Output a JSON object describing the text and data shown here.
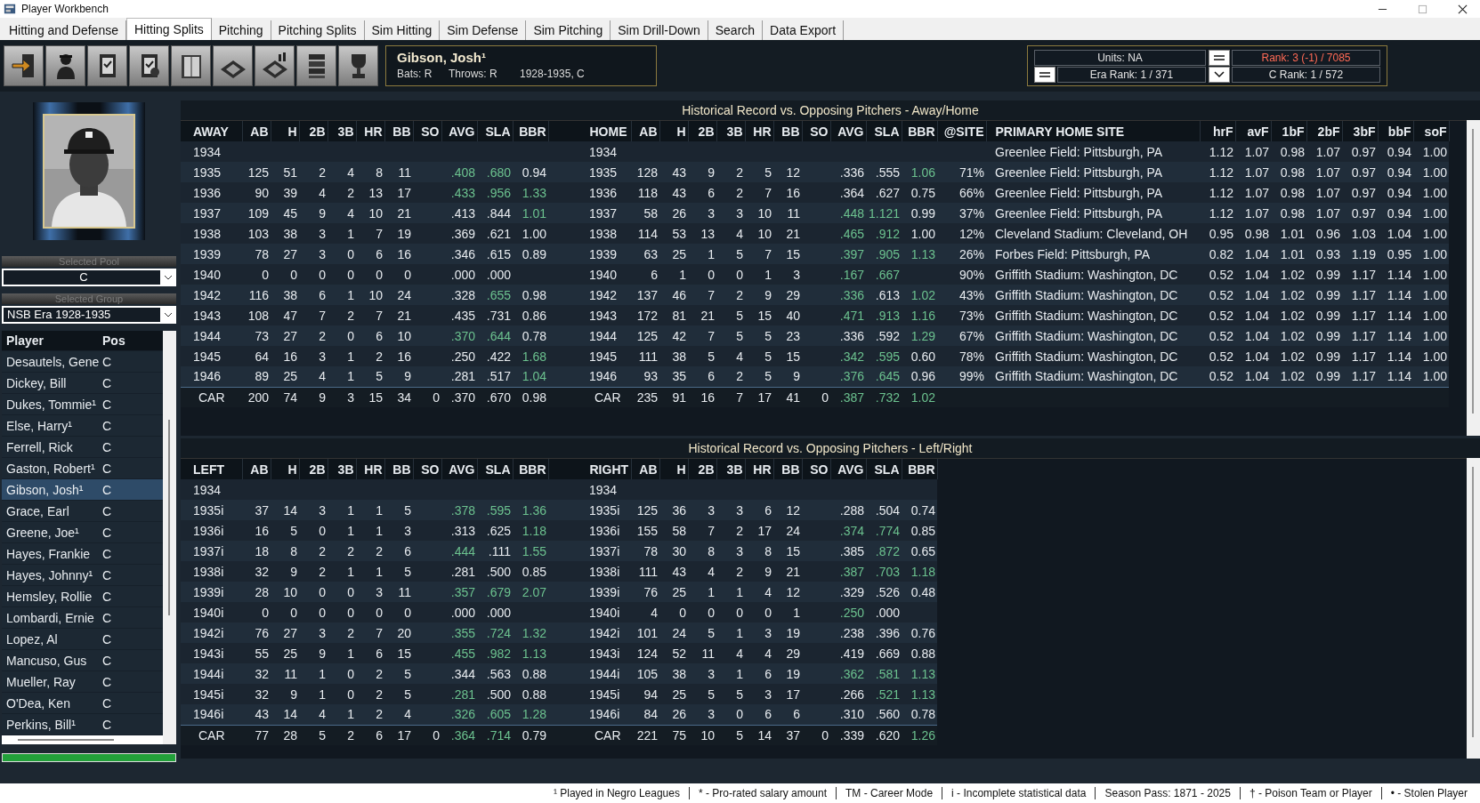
{
  "window": {
    "title": "Player Workbench"
  },
  "tabs": [
    {
      "label": "Hitting and Defense",
      "selected": false
    },
    {
      "label": "Hitting Splits",
      "selected": true
    },
    {
      "label": "Pitching",
      "selected": false
    },
    {
      "label": "Pitching Splits",
      "selected": false
    },
    {
      "label": "Sim Hitting",
      "selected": false
    },
    {
      "label": "Sim Defense",
      "selected": false
    },
    {
      "label": "Sim Pitching",
      "selected": false
    },
    {
      "label": "Sim Drill-Down",
      "selected": false
    },
    {
      "label": "Search",
      "selected": false
    },
    {
      "label": "Data Export",
      "selected": false
    }
  ],
  "player": {
    "name": "Gibson, Josh¹",
    "bats": "Bats: R",
    "throws": "Throws: R",
    "years_position": "1928-1935, C"
  },
  "rank_panel": {
    "units": "Units: NA",
    "rank": "Rank: 3 (-1) / 7085",
    "era_rank": "Era Rank: 1 / 371",
    "position_rank": "C Rank: 1 / 572"
  },
  "sidebar": {
    "pool_label": "Selected Pool",
    "pool": "C",
    "group_label": "Selected Group",
    "group": "NSB Era 1928-1935",
    "list_columns": [
      "Player",
      "Pos"
    ],
    "players": [
      {
        "name": "Desautels, Gene",
        "pos": "C",
        "selected": false
      },
      {
        "name": "Dickey, Bill",
        "pos": "C",
        "selected": false
      },
      {
        "name": "Dukes, Tommie¹",
        "pos": "C",
        "selected": false
      },
      {
        "name": "Else, Harry¹",
        "pos": "C",
        "selected": false
      },
      {
        "name": "Ferrell, Rick",
        "pos": "C",
        "selected": false
      },
      {
        "name": "Gaston, Robert¹",
        "pos": "C",
        "selected": false
      },
      {
        "name": "Gibson, Josh¹",
        "pos": "C",
        "selected": true
      },
      {
        "name": "Grace, Earl",
        "pos": "C",
        "selected": false
      },
      {
        "name": "Greene, Joe¹",
        "pos": "C",
        "selected": false
      },
      {
        "name": "Hayes, Frankie",
        "pos": "C",
        "selected": false
      },
      {
        "name": "Hayes, Johnny¹",
        "pos": "C",
        "selected": false
      },
      {
        "name": "Hemsley, Rollie",
        "pos": "C",
        "selected": false
      },
      {
        "name": "Lombardi, Ernie",
        "pos": "C",
        "selected": false
      },
      {
        "name": "Lopez, Al",
        "pos": "C",
        "selected": false
      },
      {
        "name": "Mancuso, Gus",
        "pos": "C",
        "selected": false
      },
      {
        "name": "Mueller, Ray",
        "pos": "C",
        "selected": false
      },
      {
        "name": "O'Dea, Ken",
        "pos": "C",
        "selected": false
      },
      {
        "name": "Perkins, Bill¹",
        "pos": "C",
        "selected": false
      }
    ],
    "progress": {
      "level": 1
    }
  },
  "away_home": {
    "title": "Historical Record vs. Opposing Pitchers - Away/Home",
    "columns": [
      {
        "label": "AWAY",
        "kind": "year"
      },
      {
        "label": "AB",
        "kind": "count"
      },
      {
        "label": "H",
        "kind": "count"
      },
      {
        "label": "2B",
        "kind": "count"
      },
      {
        "label": "3B",
        "kind": "count"
      },
      {
        "label": "HR",
        "kind": "count"
      },
      {
        "label": "BB",
        "kind": "count"
      },
      {
        "label": "SO",
        "kind": "count"
      },
      {
        "label": "AVG",
        "kind": "rate"
      },
      {
        "label": "SLA",
        "kind": "rate"
      },
      {
        "label": "BBR",
        "kind": "rate"
      },
      {
        "label": "HOME",
        "kind": "year"
      },
      {
        "label": "AB",
        "kind": "count"
      },
      {
        "label": "H",
        "kind": "count"
      },
      {
        "label": "2B",
        "kind": "count"
      },
      {
        "label": "3B",
        "kind": "count"
      },
      {
        "label": "HR",
        "kind": "count"
      },
      {
        "label": "BB",
        "kind": "count"
      },
      {
        "label": "SO",
        "kind": "count"
      },
      {
        "label": "AVG",
        "kind": "rate"
      },
      {
        "label": "SLA",
        "kind": "rate"
      },
      {
        "label": "BBR",
        "kind": "rate"
      },
      {
        "label": "@SITE",
        "kind": "pct"
      },
      {
        "label": "PRIMARY HOME SITE",
        "kind": "site"
      },
      {
        "label": "hrF",
        "kind": "factor"
      },
      {
        "label": "avF",
        "kind": "factor"
      },
      {
        "label": "1bF",
        "kind": "factor"
      },
      {
        "label": "2bF",
        "kind": "factor"
      },
      {
        "label": "3bF",
        "kind": "factor"
      },
      {
        "label": "bbF",
        "kind": "factor"
      },
      {
        "label": "soF",
        "kind": "factor"
      }
    ],
    "rows": [
      {
        "kind": "season",
        "cells": [
          "1934",
          null,
          null,
          null,
          null,
          null,
          null,
          null,
          null,
          null,
          null,
          "1934",
          null,
          null,
          null,
          null,
          null,
          null,
          null,
          null,
          null,
          null,
          null,
          "Greenlee Field: Pittsburgh, PA",
          "1.12",
          "1.07",
          "0.98",
          "1.07",
          "0.97",
          "0.94",
          "1.00"
        ]
      },
      {
        "kind": "season",
        "cells": [
          "1935",
          "125",
          "51",
          "2",
          "4",
          "8",
          "11",
          null,
          {
            "v": ".408",
            "good": true
          },
          {
            "v": ".680",
            "good": true
          },
          {
            "v": "0.94",
            "good": false
          },
          "1935",
          "128",
          "43",
          "9",
          "2",
          "5",
          "12",
          null,
          {
            "v": ".336",
            "good": false
          },
          {
            "v": ".555",
            "good": false
          },
          {
            "v": "1.06",
            "good": true
          },
          "71%",
          "Greenlee Field: Pittsburgh, PA",
          "1.12",
          "1.07",
          "0.98",
          "1.07",
          "0.97",
          "0.94",
          "1.00"
        ]
      },
      {
        "kind": "season",
        "cells": [
          "1936",
          "90",
          "39",
          "4",
          "2",
          "13",
          "17",
          null,
          {
            "v": ".433",
            "good": true
          },
          {
            "v": ".956",
            "good": true
          },
          {
            "v": "1.33",
            "good": true
          },
          "1936",
          "118",
          "43",
          "6",
          "2",
          "7",
          "16",
          null,
          {
            "v": ".364",
            "good": false
          },
          {
            "v": ".627",
            "good": false
          },
          {
            "v": "0.75",
            "good": false
          },
          "66%",
          "Greenlee Field: Pittsburgh, PA",
          "1.12",
          "1.07",
          "0.98",
          "1.07",
          "0.97",
          "0.94",
          "1.00"
        ]
      },
      {
        "kind": "season",
        "cells": [
          "1937",
          "109",
          "45",
          "9",
          "4",
          "10",
          "21",
          null,
          {
            "v": ".413",
            "good": false
          },
          {
            "v": ".844",
            "good": false
          },
          {
            "v": "1.01",
            "good": true
          },
          "1937",
          "58",
          "26",
          "3",
          "3",
          "10",
          "11",
          null,
          {
            "v": ".448",
            "good": true
          },
          {
            "v": "1.121",
            "good": true
          },
          {
            "v": "0.99",
            "good": false
          },
          "37%",
          "Greenlee Field: Pittsburgh, PA",
          "1.12",
          "1.07",
          "0.98",
          "1.07",
          "0.97",
          "0.94",
          "1.00"
        ]
      },
      {
        "kind": "season",
        "cells": [
          "1938",
          "103",
          "38",
          "3",
          "1",
          "7",
          "19",
          null,
          {
            "v": ".369",
            "good": false
          },
          {
            "v": ".621",
            "good": false
          },
          {
            "v": "1.00",
            "good": false
          },
          "1938",
          "114",
          "53",
          "13",
          "4",
          "10",
          "21",
          null,
          {
            "v": ".465",
            "good": true
          },
          {
            "v": ".912",
            "good": true
          },
          {
            "v": "1.00",
            "good": false
          },
          "12%",
          "Cleveland Stadium: Cleveland, OH",
          "0.95",
          "0.98",
          "1.01",
          "0.96",
          "1.03",
          "1.04",
          "1.00"
        ]
      },
      {
        "kind": "season",
        "cells": [
          "1939",
          "78",
          "27",
          "3",
          "0",
          "6",
          "16",
          null,
          {
            "v": ".346",
            "good": false
          },
          {
            "v": ".615",
            "good": false
          },
          {
            "v": "0.89",
            "good": false
          },
          "1939",
          "63",
          "25",
          "1",
          "5",
          "7",
          "15",
          null,
          {
            "v": ".397",
            "good": true
          },
          {
            "v": ".905",
            "good": true
          },
          {
            "v": "1.13",
            "good": true
          },
          "26%",
          "Forbes Field: Pittsburgh, PA",
          "0.82",
          "1.04",
          "1.01",
          "0.93",
          "1.19",
          "0.95",
          "1.00"
        ]
      },
      {
        "kind": "season",
        "cells": [
          "1940",
          "0",
          "0",
          "0",
          "0",
          "0",
          "0",
          null,
          {
            "v": ".000",
            "good": false
          },
          {
            "v": ".000",
            "good": false
          },
          null,
          "1940",
          "6",
          "1",
          "0",
          "0",
          "1",
          "3",
          null,
          {
            "v": ".167",
            "good": true
          },
          {
            "v": ".667",
            "good": true
          },
          null,
          "90%",
          "Griffith Stadium: Washington, DC",
          "0.52",
          "1.04",
          "1.02",
          "0.99",
          "1.17",
          "1.14",
          "1.00"
        ]
      },
      {
        "kind": "season",
        "cells": [
          "1942",
          "116",
          "38",
          "6",
          "1",
          "10",
          "24",
          null,
          {
            "v": ".328",
            "good": false
          },
          {
            "v": ".655",
            "good": true
          },
          {
            "v": "0.98",
            "good": false
          },
          "1942",
          "137",
          "46",
          "7",
          "2",
          "9",
          "29",
          null,
          {
            "v": ".336",
            "good": true
          },
          {
            "v": ".613",
            "good": false
          },
          {
            "v": "1.02",
            "good": true
          },
          "43%",
          "Griffith Stadium: Washington, DC",
          "0.52",
          "1.04",
          "1.02",
          "0.99",
          "1.17",
          "1.14",
          "1.00"
        ]
      },
      {
        "kind": "season",
        "cells": [
          "1943",
          "108",
          "47",
          "7",
          "2",
          "7",
          "21",
          null,
          {
            "v": ".435",
            "good": false
          },
          {
            "v": ".731",
            "good": false
          },
          {
            "v": "0.86",
            "good": false
          },
          "1943",
          "172",
          "81",
          "21",
          "5",
          "15",
          "40",
          null,
          {
            "v": ".471",
            "good": true
          },
          {
            "v": ".913",
            "good": true
          },
          {
            "v": "1.16",
            "good": true
          },
          "73%",
          "Griffith Stadium: Washington, DC",
          "0.52",
          "1.04",
          "1.02",
          "0.99",
          "1.17",
          "1.14",
          "1.00"
        ]
      },
      {
        "kind": "season",
        "cells": [
          "1944",
          "73",
          "27",
          "2",
          "0",
          "6",
          "10",
          null,
          {
            "v": ".370",
            "good": true
          },
          {
            "v": ".644",
            "good": true
          },
          {
            "v": "0.78",
            "good": false
          },
          "1944",
          "125",
          "42",
          "7",
          "5",
          "5",
          "23",
          null,
          {
            "v": ".336",
            "good": false
          },
          {
            "v": ".592",
            "good": false
          },
          {
            "v": "1.29",
            "good": true
          },
          "67%",
          "Griffith Stadium: Washington, DC",
          "0.52",
          "1.04",
          "1.02",
          "0.99",
          "1.17",
          "1.14",
          "1.00"
        ]
      },
      {
        "kind": "season",
        "cells": [
          "1945",
          "64",
          "16",
          "3",
          "1",
          "2",
          "16",
          null,
          {
            "v": ".250",
            "good": false
          },
          {
            "v": ".422",
            "good": false
          },
          {
            "v": "1.68",
            "good": true
          },
          "1945",
          "111",
          "38",
          "5",
          "4",
          "5",
          "15",
          null,
          {
            "v": ".342",
            "good": true
          },
          {
            "v": ".595",
            "good": true
          },
          {
            "v": "0.60",
            "good": false
          },
          "78%",
          "Griffith Stadium: Washington, DC",
          "0.52",
          "1.04",
          "1.02",
          "0.99",
          "1.17",
          "1.14",
          "1.00"
        ]
      },
      {
        "kind": "season",
        "cells": [
          "1946",
          "89",
          "25",
          "4",
          "1",
          "5",
          "9",
          null,
          {
            "v": ".281",
            "good": false
          },
          {
            "v": ".517",
            "good": false
          },
          {
            "v": "1.04",
            "good": true
          },
          "1946",
          "93",
          "35",
          "6",
          "2",
          "5",
          "9",
          null,
          {
            "v": ".376",
            "good": true
          },
          {
            "v": ".645",
            "good": true
          },
          {
            "v": "0.96",
            "good": false
          },
          "99%",
          "Griffith Stadium: Washington, DC",
          "0.52",
          "1.04",
          "1.02",
          "0.99",
          "1.17",
          "1.14",
          "1.00"
        ]
      },
      {
        "kind": "career",
        "cells": [
          "CAR",
          "200",
          "74",
          "9",
          "3",
          "15",
          "34",
          "0",
          {
            "v": ".370",
            "good": false
          },
          {
            "v": ".670",
            "good": false
          },
          {
            "v": "0.98",
            "good": false
          },
          "CAR",
          "235",
          "91",
          "16",
          "7",
          "17",
          "41",
          "0",
          {
            "v": ".387",
            "good": true
          },
          {
            "v": ".732",
            "good": true
          },
          {
            "v": "1.02",
            "good": true
          },
          null,
          null,
          null,
          null,
          null,
          null,
          null,
          null,
          null
        ]
      }
    ]
  },
  "left_right": {
    "title": "Historical Record vs. Opposing Pitchers - Left/Right",
    "columns": [
      {
        "label": "LEFT",
        "kind": "year"
      },
      {
        "label": "AB",
        "kind": "count"
      },
      {
        "label": "H",
        "kind": "count"
      },
      {
        "label": "2B",
        "kind": "count"
      },
      {
        "label": "3B",
        "kind": "count"
      },
      {
        "label": "HR",
        "kind": "count"
      },
      {
        "label": "BB",
        "kind": "count"
      },
      {
        "label": "SO",
        "kind": "count"
      },
      {
        "label": "AVG",
        "kind": "rate"
      },
      {
        "label": "SLA",
        "kind": "rate"
      },
      {
        "label": "BBR",
        "kind": "rate"
      },
      {
        "label": "RIGHT",
        "kind": "year"
      },
      {
        "label": "AB",
        "kind": "count"
      },
      {
        "label": "H",
        "kind": "count"
      },
      {
        "label": "2B",
        "kind": "count"
      },
      {
        "label": "3B",
        "kind": "count"
      },
      {
        "label": "HR",
        "kind": "count"
      },
      {
        "label": "BB",
        "kind": "count"
      },
      {
        "label": "SO",
        "kind": "count"
      },
      {
        "label": "AVG",
        "kind": "rate"
      },
      {
        "label": "SLA",
        "kind": "rate"
      },
      {
        "label": "BBR",
        "kind": "rate"
      }
    ],
    "rows": [
      {
        "kind": "season",
        "cells": [
          "1934",
          null,
          null,
          null,
          null,
          null,
          null,
          null,
          null,
          null,
          null,
          "1934",
          null,
          null,
          null,
          null,
          null,
          null,
          null,
          null,
          null,
          null
        ]
      },
      {
        "kind": "season",
        "cells": [
          "1935i",
          "37",
          "14",
          "3",
          "1",
          "1",
          "5",
          null,
          {
            "v": ".378",
            "good": true
          },
          {
            "v": ".595",
            "good": true
          },
          {
            "v": "1.36",
            "good": true
          },
          "1935i",
          "125",
          "36",
          "3",
          "3",
          "6",
          "12",
          null,
          {
            "v": ".288",
            "good": false
          },
          {
            "v": ".504",
            "good": false
          },
          {
            "v": "0.74",
            "good": false
          }
        ]
      },
      {
        "kind": "season",
        "cells": [
          "1936i",
          "16",
          "5",
          "0",
          "1",
          "1",
          "3",
          null,
          {
            "v": ".313",
            "good": false
          },
          {
            "v": ".625",
            "good": false
          },
          {
            "v": "1.18",
            "good": true
          },
          "1936i",
          "155",
          "58",
          "7",
          "2",
          "17",
          "24",
          null,
          {
            "v": ".374",
            "good": true
          },
          {
            "v": ".774",
            "good": true
          },
          {
            "v": "0.85",
            "good": false
          }
        ]
      },
      {
        "kind": "season",
        "cells": [
          "1937i",
          "18",
          "8",
          "2",
          "2",
          "2",
          "6",
          null,
          {
            "v": ".444",
            "good": true
          },
          {
            "v": ".111",
            "good": false
          },
          {
            "v": "1.55",
            "good": true
          },
          "1937i",
          "78",
          "30",
          "8",
          "3",
          "8",
          "15",
          null,
          {
            "v": ".385",
            "good": false
          },
          {
            "v": ".872",
            "good": true
          },
          {
            "v": "0.65",
            "good": false
          }
        ]
      },
      {
        "kind": "season",
        "cells": [
          "1938i",
          "32",
          "9",
          "2",
          "1",
          "1",
          "5",
          null,
          {
            "v": ".281",
            "good": false
          },
          {
            "v": ".500",
            "good": false
          },
          {
            "v": "0.85",
            "good": false
          },
          "1938i",
          "111",
          "43",
          "4",
          "2",
          "9",
          "21",
          null,
          {
            "v": ".387",
            "good": true
          },
          {
            "v": ".703",
            "good": true
          },
          {
            "v": "1.18",
            "good": true
          }
        ]
      },
      {
        "kind": "season",
        "cells": [
          "1939i",
          "28",
          "10",
          "0",
          "0",
          "3",
          "11",
          null,
          {
            "v": ".357",
            "good": true
          },
          {
            "v": ".679",
            "good": true
          },
          {
            "v": "2.07",
            "good": true
          },
          "1939i",
          "76",
          "25",
          "1",
          "1",
          "4",
          "12",
          null,
          {
            "v": ".329",
            "good": false
          },
          {
            "v": ".526",
            "good": false
          },
          {
            "v": "0.48",
            "good": false
          }
        ]
      },
      {
        "kind": "season",
        "cells": [
          "1940i",
          "0",
          "0",
          "0",
          "0",
          "0",
          "0",
          null,
          {
            "v": ".000",
            "good": false
          },
          {
            "v": ".000",
            "good": false
          },
          null,
          "1940i",
          "4",
          "0",
          "0",
          "0",
          "0",
          "1",
          null,
          {
            "v": ".250",
            "good": true
          },
          {
            "v": ".000",
            "good": false
          },
          null
        ]
      },
      {
        "kind": "season",
        "cells": [
          "1942i",
          "76",
          "27",
          "3",
          "2",
          "7",
          "20",
          null,
          {
            "v": ".355",
            "good": true
          },
          {
            "v": ".724",
            "good": true
          },
          {
            "v": "1.32",
            "good": true
          },
          "1942i",
          "101",
          "24",
          "5",
          "1",
          "3",
          "19",
          null,
          {
            "v": ".238",
            "good": false
          },
          {
            "v": ".396",
            "good": false
          },
          {
            "v": "0.76",
            "good": false
          }
        ]
      },
      {
        "kind": "season",
        "cells": [
          "1943i",
          "55",
          "25",
          "9",
          "1",
          "6",
          "15",
          null,
          {
            "v": ".455",
            "good": true
          },
          {
            "v": ".982",
            "good": true
          },
          {
            "v": "1.13",
            "good": true
          },
          "1943i",
          "124",
          "52",
          "11",
          "4",
          "4",
          "29",
          null,
          {
            "v": ".419",
            "good": false
          },
          {
            "v": ".669",
            "good": false
          },
          {
            "v": "0.88",
            "good": false
          }
        ]
      },
      {
        "kind": "season",
        "cells": [
          "1944i",
          "32",
          "11",
          "1",
          "0",
          "2",
          "5",
          null,
          {
            "v": ".344",
            "good": false
          },
          {
            "v": ".563",
            "good": false
          },
          {
            "v": "0.88",
            "good": false
          },
          "1944i",
          "105",
          "38",
          "3",
          "1",
          "6",
          "19",
          null,
          {
            "v": ".362",
            "good": true
          },
          {
            "v": ".581",
            "good": true
          },
          {
            "v": "1.13",
            "good": true
          }
        ]
      },
      {
        "kind": "season",
        "cells": [
          "1945i",
          "32",
          "9",
          "1",
          "0",
          "2",
          "5",
          null,
          {
            "v": ".281",
            "good": true
          },
          {
            "v": ".500",
            "good": false
          },
          {
            "v": "0.88",
            "good": false
          },
          "1945i",
          "94",
          "25",
          "5",
          "5",
          "3",
          "17",
          null,
          {
            "v": ".266",
            "good": false
          },
          {
            "v": ".521",
            "good": true
          },
          {
            "v": "1.13",
            "good": true
          }
        ]
      },
      {
        "kind": "season",
        "cells": [
          "1946i",
          "43",
          "14",
          "4",
          "1",
          "2",
          "4",
          null,
          {
            "v": ".326",
            "good": true
          },
          {
            "v": ".605",
            "good": true
          },
          {
            "v": "1.28",
            "good": true
          },
          "1946i",
          "84",
          "26",
          "3",
          "0",
          "6",
          "6",
          null,
          {
            "v": ".310",
            "good": false
          },
          {
            "v": ".560",
            "good": false
          },
          {
            "v": "0.78",
            "good": false
          }
        ]
      },
      {
        "kind": "career",
        "cells": [
          "CAR",
          "77",
          "28",
          "5",
          "2",
          "6",
          "17",
          "0",
          {
            "v": ".364",
            "good": true
          },
          {
            "v": ".714",
            "good": true
          },
          {
            "v": "0.79",
            "good": false
          },
          "CAR",
          "221",
          "75",
          "10",
          "5",
          "14",
          "37",
          "0",
          {
            "v": ".339",
            "good": false
          },
          {
            "v": ".620",
            "good": false
          },
          {
            "v": "1.26",
            "good": true
          }
        ]
      }
    ]
  },
  "status_bar": [
    "¹ Played in Negro Leagues",
    "* - Pro-rated salary amount",
    "TM - Career Mode",
    "i - Incomplete statistical data",
    "Season Pass: 1871 - 2025",
    "† - Poison Team or Player",
    "• - Stolen Player"
  ]
}
